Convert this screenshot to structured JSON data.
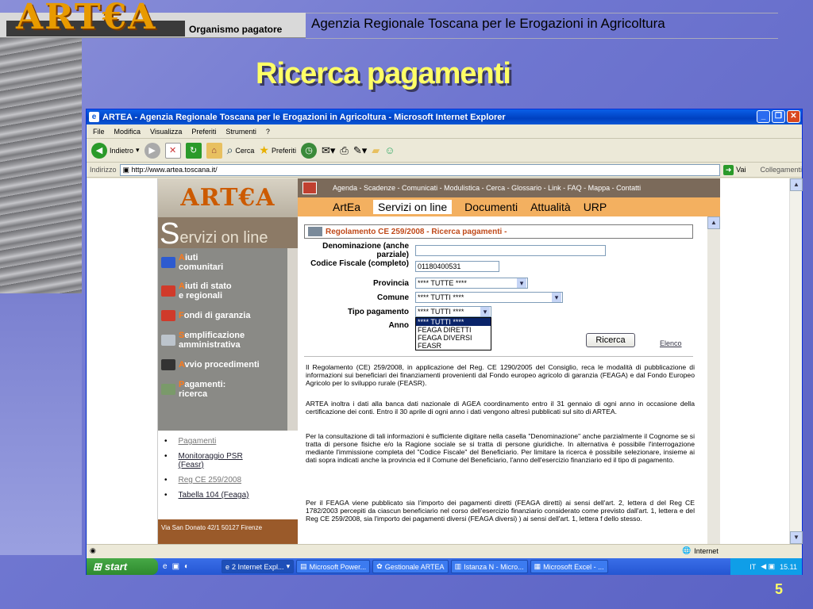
{
  "slide": {
    "brand": "ART€A",
    "organism": "Organismo pagatore",
    "agency": "Agenzia Regionale Toscana per le Erogazioni in Agricoltura",
    "title": "Ricerca pagamenti",
    "number": "5"
  },
  "window": {
    "title": "ARTEA - Agenzia Regionale Toscana per le Erogazioni in Agricoltura - Microsoft Internet Explorer",
    "menu": [
      "File",
      "Modifica",
      "Visualizza",
      "Preferiti",
      "Strumenti",
      "?"
    ],
    "toolbar": {
      "back": "Indietro",
      "search": "Cerca",
      "favorites": "Preferiti"
    },
    "address_label": "Indirizzo",
    "address": "http://www.artea.toscana.it/",
    "go": "Vai",
    "links": "Collegamenti",
    "status": "Internet"
  },
  "site": {
    "logo": "ART€A",
    "servizi_big": "S",
    "servizi_rest": "ervizi on line",
    "topnav": "Agenda - Scadenze - Comunicati - Modulistica - Cerca - Glossario - Link - FAQ - Mappa - Contatti",
    "tabs": [
      "ArtEa",
      "Servizi on line",
      "Documenti",
      "Attualità",
      "URP"
    ],
    "nav": [
      {
        "first": "A",
        "rest": "iuti\ncomunitari",
        "color": "#2d5bd0"
      },
      {
        "first": "A",
        "rest": "iuti di stato\ne regionali",
        "color": "#d03a2a"
      },
      {
        "first": "F",
        "rest": "ondi di garanzia",
        "color": "#d03a2a"
      },
      {
        "first": "S",
        "rest": "emplificazione\namministrativa",
        "color": "#bcc4cc"
      },
      {
        "first": "A",
        "rest": "vvio procedimenti",
        "color": "#333333"
      },
      {
        "first": "P",
        "rest": "agamenti:\nricerca",
        "color": "#7a9a6a"
      }
    ],
    "sub": [
      {
        "label": "Pagamenti",
        "dim": true
      },
      {
        "label": "Monitoraggio PSR\n(Feasr)",
        "dim": false
      },
      {
        "label": "Reg CE 259/2008",
        "dim": true
      },
      {
        "label": "Tabella 104 (Feaga)",
        "dim": false
      }
    ],
    "footer": "Via San Donato 42/1 50127 Firenze"
  },
  "form": {
    "header": "Regolamento CE 259/2008 - Ricerca pagamenti -",
    "denominazione_label": "Denominazione (anche parziale)",
    "codice_label": "Codice Fiscale (completo)",
    "codice_value": "01180400531",
    "provincia_label": "Provincia",
    "provincia_value": "**** TUTTE ****",
    "comune_label": "Comune",
    "comune_value": "**** TUTTI ****",
    "tipo_label": "Tipo pagamento",
    "tipo_value": "**** TUTTI ****",
    "anno_label": "Anno",
    "dropdown_options": [
      "**** TUTTI ****",
      "FEAGA DIRETTI",
      "FEAGA DIVERSI",
      "FEASR"
    ],
    "search_button": "Ricerca",
    "elenco": "Elenco",
    "paragraphs": [
      "Il Regolamento (CE) 259/2008, in applicazione del Reg. CE 1290/2005 del Consiglio, reca le modalità di pubblicazione di informazioni sui beneficiari dei finanziamenti provenienti dal Fondo europeo agricolo di garanzia (FEAGA) e dal Fondo Europeo Agricolo per lo sviluppo rurale (FEASR).",
      "ARTEA inoltra i dati alla banca dati nazionale di AGEA coordinamento entro il 31 gennaio di ogni anno in occasione della certificazione dei conti. Entro il 30 aprile di ogni anno i dati vengono altresì pubblicati sul sito di ARTEA.",
      "Per la consultazione di tali informazioni è sufficiente digitare nella casella \"Denominazione\" anche parzialmente il Cognome se si tratta di persone fisiche e/o la Ragione sociale se si tratta di persone giuridiche. In alternativa è possibile l'interrogazione mediante l'immissione completa del \"Codice Fiscale\" del Beneficiario. Per limitare la ricerca è possibile selezionare, insieme ai dati sopra indicati anche la provincia ed il Comune del Beneficiario, l'anno dell'esercizio finanziario ed il tipo di pagamento.",
      "Per il FEAGA viene pubblicato sia l'importo dei pagamenti diretti (FEAGA diretti) ai sensi dell'art. 2, lettera d del Reg CE 1782/2003 percepiti da ciascun beneficiario nel corso dell'esercizio finanziario considerato come previsto dall'art. 1, lettera e del Reg CE 259/2008, sia l'importo dei pagamenti diversi (FEAGA diversi) ) ai sensi dell'art. 1, lettera f dello stesso."
    ]
  },
  "taskbar": {
    "start": "start",
    "tasks": [
      "2 Internet Expl...",
      "Microsoft Power...",
      "Gestionale ARTEA",
      "Istanza N - Micro...",
      "Microsoft Excel - ..."
    ],
    "lang": "IT",
    "clock": "15.11"
  },
  "colors": {
    "accent": "#ffff66",
    "brand": "#e89a00",
    "xp_blue": "#0a58d6"
  }
}
